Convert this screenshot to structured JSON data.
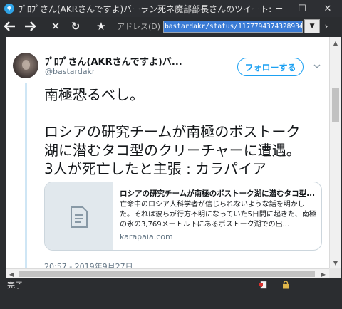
{
  "window": {
    "title": "ﾌﾟﾛﾌﾟさん(AKRさんですよ)バーラン死ネ魔部部長さんのツイート: \"",
    "minimize_glyph": "─",
    "maximize_glyph": "☐",
    "close_glyph": "✕"
  },
  "toolbar": {
    "back_glyph": "🡐",
    "forward_glyph": "🡒",
    "stop_glyph": "✕",
    "reload_glyph": "↻",
    "favorite_glyph": "★",
    "address_label": "アドレス(D)",
    "address_value": "bastardakr/status/1177794374328934400",
    "dropdown_glyph": "▼",
    "next_glyph": "›"
  },
  "tweet": {
    "display_name": "ﾌﾟﾛﾌﾟさん(AKRさんですよ)バ...",
    "handle": "@bastardakr",
    "follow_label": "フォローする",
    "text_line1": "南極恐るべし。",
    "text_line2": "ロシアの研究チームが南極のボストーク",
    "text_line3": "湖に潜むタコ型のクリーチャーに遭遇。",
    "text_line4": "3人が死亡したと主張 : カラパイア",
    "card_title": "ロシアの研究チームが南極のボストーク湖に潜むタコ型...",
    "card_description": "亡命中のロシア人科学者が信じられないような話を明かした。それは彼らが行方不明になっていた5日間に起きた、南極の氷の3,769メートル下にあるボストーク湖での出...",
    "card_domain": "karapaia.com",
    "timestamp": "20:57 - 2019年9月27日"
  },
  "scrollbars": {
    "up_glyph": "▲",
    "down_glyph": "▼",
    "left_glyph": "◀",
    "right_glyph": "▶"
  },
  "statusbar": {
    "text": "完了"
  },
  "colors": {
    "accent": "#1da1f2",
    "chrome": "#2b2d30",
    "thread_line": "#cfe6f5"
  }
}
